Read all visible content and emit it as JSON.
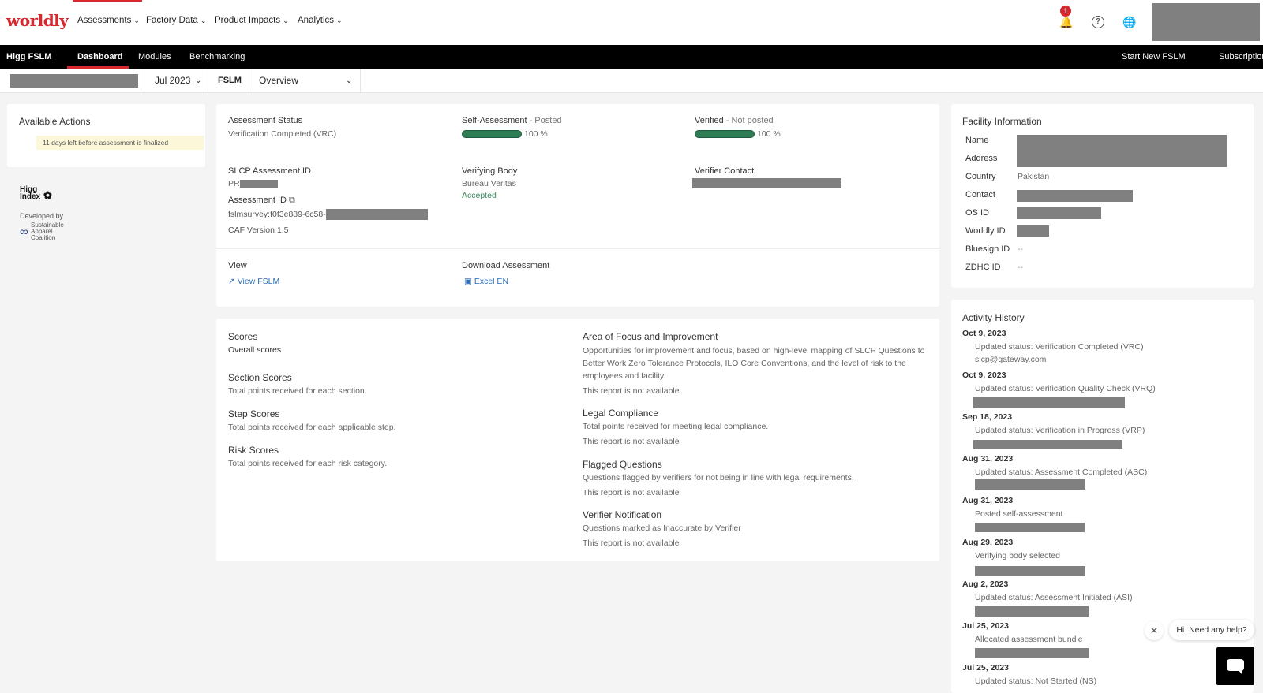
{
  "topnav": {
    "logo": "worldly",
    "menus": [
      "Assessments",
      "Factory Data",
      "Product Impacts",
      "Analytics"
    ],
    "notification_count": "1"
  },
  "subnav": {
    "brand": "Higg FSLM",
    "tabs": [
      "Dashboard",
      "Modules",
      "Benchmarking"
    ],
    "right_links": [
      "Start New FSLM",
      "Subscriptions"
    ]
  },
  "filter": {
    "period": "Jul 2023",
    "module": "FSLM",
    "view": "Overview"
  },
  "actions": {
    "title": "Available Actions",
    "notice": "11 days left before assessment is finalized",
    "higg_logo": "Higg Index",
    "developed_by": "Developed by",
    "sac_logo": "Sustainable Apparel Coalition"
  },
  "assessment": {
    "status_label": "Assessment Status",
    "status_value": "Verification Completed (VRC)",
    "self_label": "Self-Assessment",
    "self_state": " - Posted",
    "self_pct": "100 %",
    "self_progress": 1.0,
    "verified_label": "Verified",
    "verified_state": " - Not posted",
    "verified_pct": "100 %",
    "verified_progress": 1.0,
    "slcp_label": "SLCP Assessment ID",
    "slcp_prefix": "PR",
    "vbody_label": "Verifying Body",
    "vbody_value": "Bureau Veritas",
    "vbody_status": "Accepted",
    "vcontact_label": "Verifier Contact",
    "aid_label": "Assessment ID",
    "aid_value": "fslmsurvey:f0f3e889-6c58-",
    "caf": "CAF Version 1.5",
    "view_label": "View",
    "view_link": "View FSLM",
    "download_label": "Download Assessment",
    "download_link": "Excel EN"
  },
  "scores": {
    "title": "Scores",
    "subtitle": "Overall scores",
    "sections": [
      {
        "title": "Section Scores",
        "desc": "Total points received for each section."
      },
      {
        "title": "Step Scores",
        "desc": "Total points received for each applicable step."
      },
      {
        "title": "Risk Scores",
        "desc": "Total points received for each risk category."
      }
    ],
    "reports": [
      {
        "title": "Area of Focus and Improvement",
        "desc1": "Opportunities for improvement and focus, based on high-level mapping of SLCP Questions to",
        "desc2": "Better Work Zero Tolerance Protocols, ILO Core Conventions, and the level of risk to the",
        "desc3": "employees and facility.",
        "status": "This report is not available"
      },
      {
        "title": "Legal Compliance",
        "desc1": "Total points received for meeting legal compliance.",
        "status": "This report is not available"
      },
      {
        "title": "Flagged Questions",
        "desc1": "Questions flagged by verifiers for not being in line with legal requirements.",
        "status": "This report is not available"
      },
      {
        "title": "Verifier Notification",
        "desc1": "Questions marked as Inaccurate by Verifier",
        "status": "This report is not available"
      }
    ]
  },
  "facility": {
    "title": "Facility Information",
    "fields": [
      "Name",
      "Address",
      "Country",
      "Contact",
      "OS ID",
      "Worldly ID",
      "Bluesign ID",
      "ZDHC ID"
    ],
    "country_value": "Pakistan",
    "bluesign_value": "--",
    "zdhc_value": "--"
  },
  "activity": {
    "title": "Activity History",
    "items": [
      {
        "date": "Oct 9, 2023",
        "text": "Updated status: Verification Completed (VRC)",
        "sub": "slcp@gateway.com"
      },
      {
        "date": "Oct 9, 2023",
        "text": "Updated status: Verification Quality Check (VRQ)"
      },
      {
        "date": "Sep 18, 2023",
        "text": "Updated status: Verification in Progress (VRP)"
      },
      {
        "date": "Aug 31, 2023",
        "text": "Updated status: Assessment Completed (ASC)"
      },
      {
        "date": "Aug 31, 2023",
        "text": "Posted self-assessment"
      },
      {
        "date": "Aug 29, 2023",
        "text": "Verifying body selected"
      },
      {
        "date": "Aug 2, 2023",
        "text": "Updated status: Assessment Initiated (ASI)"
      },
      {
        "date": "Jul 25, 2023",
        "text": "Allocated assessment bundle"
      },
      {
        "date": "Jul 25, 2023",
        "text": "Updated status: Not Started (NS)"
      }
    ]
  },
  "chat": {
    "bubble": "Hi. Need any help?"
  }
}
